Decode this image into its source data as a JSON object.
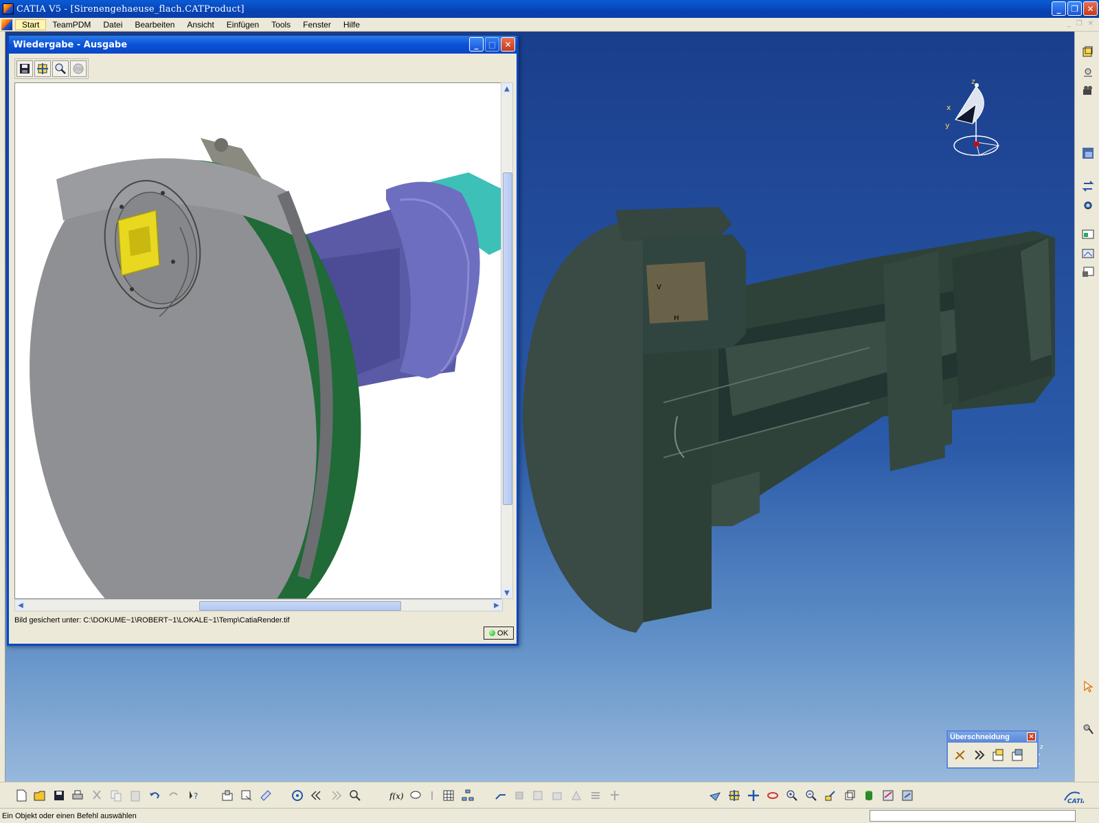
{
  "window": {
    "title": "CATIA V5 - [Sirenengehaeuse_flach.CATProduct]"
  },
  "menu": {
    "items": [
      "Start",
      "TeamPDM",
      "Datei",
      "Bearbeiten",
      "Ansicht",
      "Einfügen",
      "Tools",
      "Fenster",
      "Hilfe"
    ]
  },
  "dialog": {
    "title": "Wiedergabe - Ausgabe",
    "toolbar": [
      "save-icon",
      "fit-all-icon",
      "zoom-icon",
      "stop-icon"
    ],
    "message": "Bild gesichert unter: C:\\DOKUME~1\\ROBERT~1\\LOKALE~1\\Temp\\CatiaRender.tif",
    "ok_label": "OK"
  },
  "compass": {
    "x_label": "x",
    "y_label": "y",
    "z_label": "z"
  },
  "floating_toolbar": {
    "title": "Überschneidung"
  },
  "status": {
    "prompt": "Ein Objekt oder einen Befehl auswählen"
  },
  "colors": {
    "viewport_top": "#1a3e8c",
    "viewport_bottom": "#98b8dc",
    "render_disc": "#8e9094",
    "render_flange": "#1f6a36",
    "render_shaft": "#5a5aa6",
    "render_port": "#e8d820",
    "section_body": "#2c4038"
  }
}
